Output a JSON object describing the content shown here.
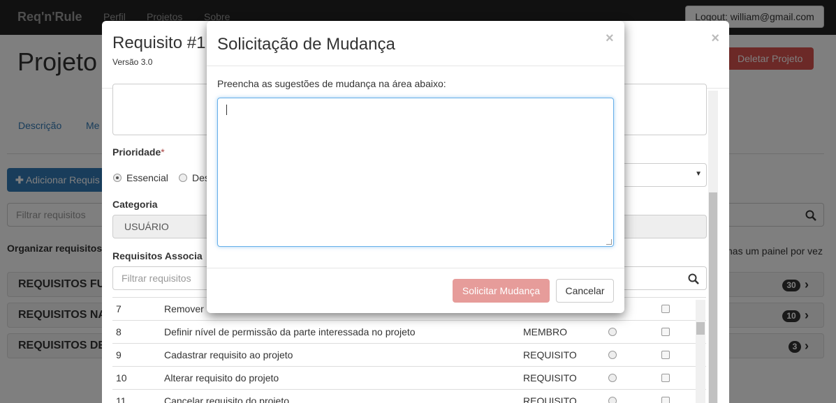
{
  "navbar": {
    "brand": "Req'n'Rule",
    "links": [
      "Perfil",
      "Projetos",
      "Sobre"
    ],
    "logout_label": "Logout: william@gmail.com"
  },
  "page": {
    "title": "Projeto",
    "delete_button": "Deletar Projeto",
    "tabs": [
      "Descrição",
      "Me"
    ],
    "add_button": "Adicionar Requis",
    "filter_placeholder": "Filtrar requisitos",
    "organize_label": "Organizar requisitos",
    "organize_right": "nas um painel por vez",
    "panels": [
      {
        "title": "REQUISITOS FU",
        "count": "30"
      },
      {
        "title": "REQUISITOS NA",
        "count": "10"
      },
      {
        "title": "REQUISITOS DE",
        "count": "3"
      }
    ]
  },
  "requirement_modal": {
    "title": "Requisito #1",
    "version": "Versão 3.0",
    "priority_label": "Prioridade",
    "required_mark": "*",
    "priority_options": [
      "Essencial",
      "Des"
    ],
    "category_label": "Categoria",
    "category_value": "USUÁRIO",
    "associated_label": "Requisitos Associa",
    "filter_placeholder": "Filtrar requisitos",
    "rows": [
      {
        "num": "7",
        "desc": "Remover",
        "type": ""
      },
      {
        "num": "8",
        "desc": "Definir nível de permissão da parte interessada no projeto",
        "type": "MEMBRO"
      },
      {
        "num": "9",
        "desc": "Cadastrar requisito ao projeto",
        "type": "REQUISITO"
      },
      {
        "num": "10",
        "desc": "Alterar requisito do projeto",
        "type": "REQUISITO"
      },
      {
        "num": "11",
        "desc": "Cancelar requisito do projeto",
        "type": "REQUISITO"
      }
    ]
  },
  "change_modal": {
    "title": "Solicitação de Mudança",
    "close_symbol": "×",
    "instruction": "Preencha as sugestões de mudança na área abaixo:",
    "textarea_value": "",
    "submit_label": "Solicitar Mudança",
    "cancel_label": "Cancelar"
  },
  "colors": {
    "navbar": "#222222",
    "primary": "#337ab7",
    "danger": "#d9534f",
    "danger_disabled": "#e69c9a"
  }
}
